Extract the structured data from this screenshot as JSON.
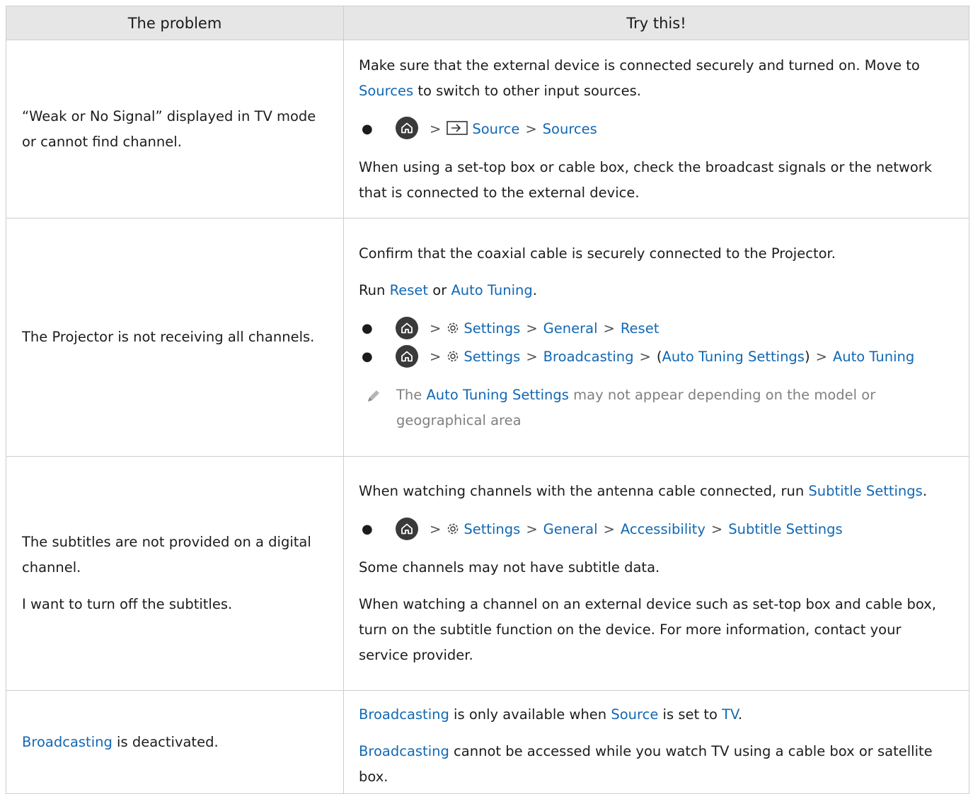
{
  "header": {
    "col1": "The problem",
    "col2": "Try this!"
  },
  "rows": [
    {
      "problem": [
        "“Weak or No Signal” displayed in TV mode or cannot find channel."
      ],
      "p1_a": "Make sure that the external device is connected securely and turned on. Move to ",
      "p1_link": "Sources",
      "p1_b": " to switch to other input sources.",
      "path": [
        "Source",
        "Sources"
      ],
      "p2": "When using a set-top box or cable box, check the broadcast signals or the network that is connected to the external device."
    },
    {
      "problem": [
        "The Projector is not receiving all channels."
      ],
      "p1": "Confirm that the coaxial cable is securely connected to the Projector.",
      "p2_a": "Run ",
      "p2_link1": "Reset",
      "p2_mid": " or ",
      "p2_link2": "Auto Tuning",
      "p2_end": ".",
      "path1": [
        "Settings",
        "General",
        "Reset"
      ],
      "path2": [
        "Settings",
        "Broadcasting",
        "Auto Tuning Settings",
        "Auto Tuning"
      ],
      "note_a": "The ",
      "note_link": "Auto Tuning Settings",
      "note_b": " may not appear depending on the model or geographical area"
    },
    {
      "problem": [
        "The subtitles are not provided on a digital channel.",
        "I want to turn off the subtitles."
      ],
      "p1_a": "When watching channels with the antenna cable connected, run ",
      "p1_link": "Subtitle Settings",
      "p1_end": ".",
      "path": [
        "Settings",
        "General",
        "Accessibility",
        "Subtitle Settings"
      ],
      "p2": "Some channels may not have subtitle data.",
      "p3": "When watching a channel on an external device such as set-top box and cable box, turn on the subtitle function on the device. For more information, contact your service provider."
    },
    {
      "problem_link": "Broadcasting",
      "problem_rest": " is deactivated.",
      "p1_link1": "Broadcasting",
      "p1_a": " is only available when ",
      "p1_link2": "Source",
      "p1_b": " is set to ",
      "p1_link3": "TV",
      "p1_end": ".",
      "p2_link": "Broadcasting",
      "p2_rest": " cannot be accessed while you watch TV using a cable box or satellite box."
    }
  ],
  "icons": {
    "home": "home-icon",
    "gear": "gear-icon",
    "source": "source-icon",
    "chevron": "chevron-right-icon",
    "note": "pencil-icon"
  },
  "colors": {
    "link": "#1268b3",
    "header_bg": "#e6e6e6",
    "border": "#cdcdcd",
    "note_text": "#808080"
  }
}
